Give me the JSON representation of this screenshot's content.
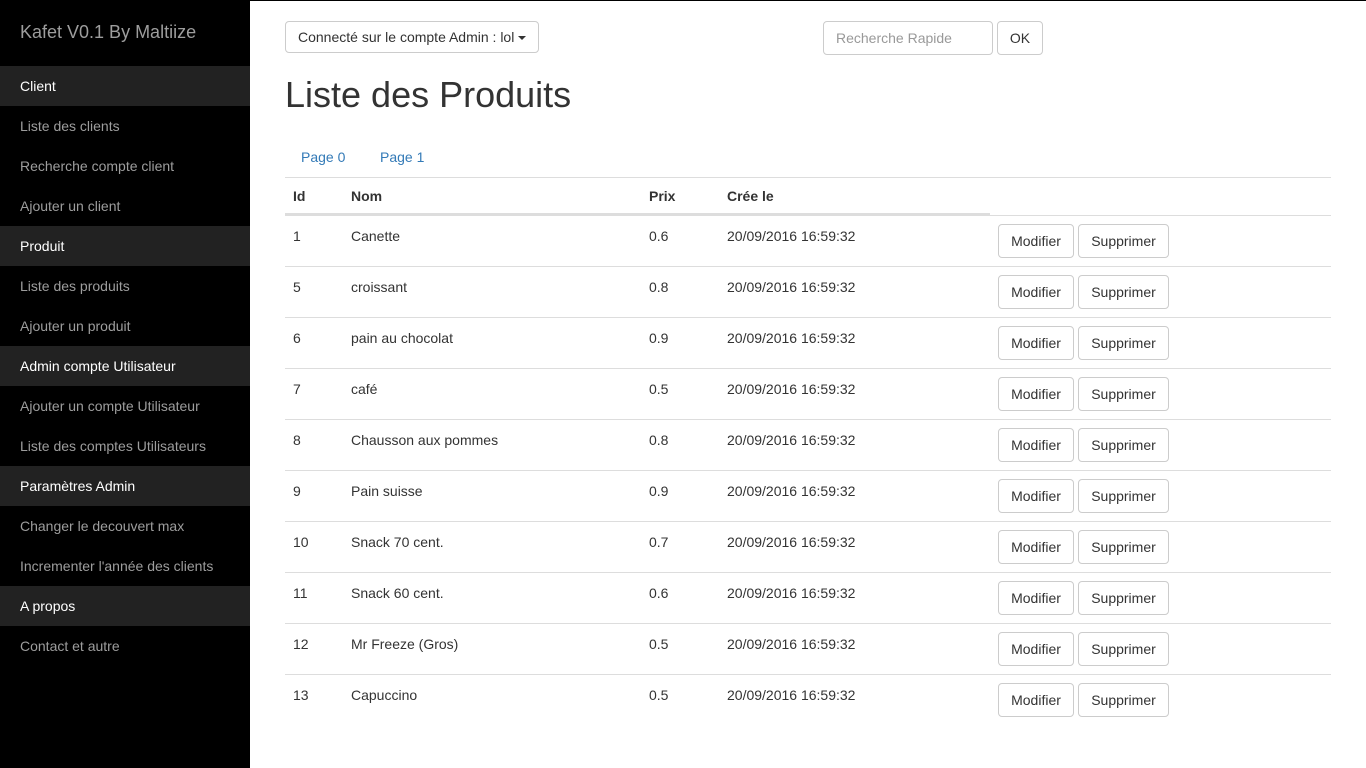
{
  "sidebar": {
    "brand": "Kafet V0.1 By Maltiize",
    "sections": [
      {
        "label": "Client",
        "items": [
          "Liste des clients",
          "Recherche compte client",
          "Ajouter un client"
        ]
      },
      {
        "label": "Produit",
        "items": [
          "Liste des produits",
          "Ajouter un produit"
        ]
      },
      {
        "label": "Admin compte Utilisateur",
        "items": [
          "Ajouter un compte Utilisateur",
          "Liste des comptes Utilisateurs"
        ]
      },
      {
        "label": "Paramètres Admin",
        "items": [
          "Changer le decouvert max",
          "Incrementer l'année des clients"
        ]
      },
      {
        "label": "A propos",
        "items": [
          "Contact et autre"
        ]
      }
    ]
  },
  "header": {
    "account_label": "Connecté sur le compte Admin : lol",
    "search_placeholder": "Recherche Rapide",
    "ok_label": "OK"
  },
  "page": {
    "title": "Liste des Produits",
    "pages": [
      "Page 0",
      "Page 1"
    ]
  },
  "table": {
    "columns": [
      "Id",
      "Nom",
      "Prix",
      "Crée le"
    ],
    "edit_label": "Modifier",
    "delete_label": "Supprimer",
    "rows": [
      {
        "id": "1",
        "nom": "Canette",
        "prix": "0.6",
        "date": "20/09/2016 16:59:32"
      },
      {
        "id": "5",
        "nom": "croissant",
        "prix": "0.8",
        "date": "20/09/2016 16:59:32"
      },
      {
        "id": "6",
        "nom": "pain au chocolat",
        "prix": "0.9",
        "date": "20/09/2016 16:59:32"
      },
      {
        "id": "7",
        "nom": "café",
        "prix": "0.5",
        "date": "20/09/2016 16:59:32"
      },
      {
        "id": "8",
        "nom": "Chausson aux pommes",
        "prix": "0.8",
        "date": "20/09/2016 16:59:32"
      },
      {
        "id": "9",
        "nom": "Pain suisse",
        "prix": "0.9",
        "date": "20/09/2016 16:59:32"
      },
      {
        "id": "10",
        "nom": "Snack 70 cent.",
        "prix": "0.7",
        "date": "20/09/2016 16:59:32"
      },
      {
        "id": "11",
        "nom": "Snack 60 cent.",
        "prix": "0.6",
        "date": "20/09/2016 16:59:32"
      },
      {
        "id": "12",
        "nom": "Mr Freeze (Gros)",
        "prix": "0.5",
        "date": "20/09/2016 16:59:32"
      },
      {
        "id": "13",
        "nom": "Capuccino",
        "prix": "0.5",
        "date": "20/09/2016 16:59:32"
      }
    ]
  }
}
